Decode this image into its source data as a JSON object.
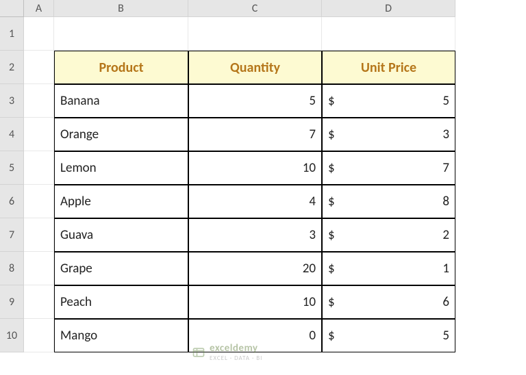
{
  "columns": [
    "A",
    "B",
    "C",
    "D"
  ],
  "rows": [
    "1",
    "2",
    "3",
    "4",
    "5",
    "6",
    "7",
    "8",
    "9",
    "10"
  ],
  "table": {
    "headers": {
      "product": "Product",
      "quantity": "Quantity",
      "price": "Unit Price"
    },
    "currency": "$",
    "items": [
      {
        "product": "Banana",
        "quantity": 5,
        "price": 5
      },
      {
        "product": "Orange",
        "quantity": 7,
        "price": 3
      },
      {
        "product": "Lemon",
        "quantity": 10,
        "price": 7
      },
      {
        "product": "Apple",
        "quantity": 4,
        "price": 8
      },
      {
        "product": "Guava",
        "quantity": 3,
        "price": 2
      },
      {
        "product": "Grape",
        "quantity": 20,
        "price": 1
      },
      {
        "product": "Peach",
        "quantity": 10,
        "price": 6
      },
      {
        "product": "Mango",
        "quantity": 0,
        "price": 5
      }
    ]
  },
  "watermark": {
    "name": "exceldemy",
    "tag": "EXCEL · DATA · BI"
  }
}
